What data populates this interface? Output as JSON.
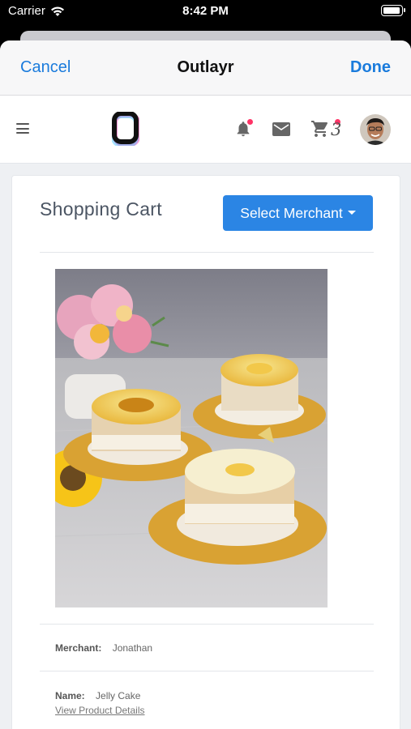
{
  "status_bar": {
    "carrier": "Carrier",
    "time": "8:42 PM",
    "battery_level": 1.0
  },
  "nav": {
    "cancel_label": "Cancel",
    "title": "Outlayr",
    "done_label": "Done"
  },
  "header": {
    "menu_icon": "hamburger-menu-icon",
    "logo_letter": "O",
    "cart_count": "3",
    "icons": [
      "bell-icon",
      "mail-icon",
      "cart-icon"
    ],
    "notification_dot_color": "#ff3366"
  },
  "cart": {
    "title": "Shopping Cart",
    "select_merchant_label": "Select Merchant",
    "merchant_label": "Merchant:",
    "merchant_value": "Jonathan",
    "name_label": "Name:",
    "name_value": "Jelly Cake",
    "view_details_link": "View Product Details"
  },
  "colors": {
    "accent": "#1a7bdc",
    "button": "#2b85e4",
    "badge": "#ff3366"
  }
}
